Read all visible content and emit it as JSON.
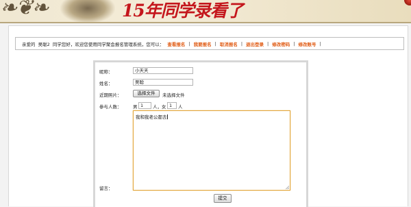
{
  "banner": {
    "slogan": "15年同学录看了"
  },
  "nav": {
    "greeting_prefix": "亲爱的",
    "username": "吴聪2",
    "greeting_suffix": "同学您好，欢迎您使用同学聚会报名管理系统，您可以：",
    "links": [
      "查看报名",
      "我要报名",
      "取消报名",
      "退出登录",
      "修改密码",
      "修改账号"
    ]
  },
  "form": {
    "nickname_label": "昵称：",
    "nickname_value": "小天天",
    "name_label": "姓名：",
    "name_value": "吴聪",
    "photo_label": "近期照片：",
    "file_button": "选择文件",
    "file_status": "未选择文件",
    "count_label": "参与人数：",
    "male_label": "男",
    "male_value": "1",
    "male_unit": "人，",
    "female_label": "女",
    "female_value": "1",
    "female_unit": "人",
    "message_label": "留言：",
    "message_value": "我和我老公都去",
    "submit_label": "提交"
  }
}
